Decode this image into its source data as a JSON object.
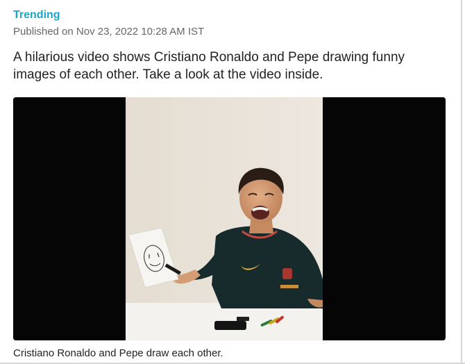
{
  "article": {
    "category": "Trending",
    "published": "Published on Nov 23, 2022 10:28 AM IST",
    "summary": "A hilarious video shows Cristiano Ronaldo and Pepe drawing funny images of each other. Take a look at the video inside."
  },
  "video": {
    "caption": "Cristiano Ronaldo and Pepe draw each other."
  },
  "colors": {
    "category": "#1aa5c8",
    "meta": "#666666",
    "text": "#222222",
    "letterbox": "#050505",
    "backdrop": "#e8e1d7",
    "shirt": "#152a2c",
    "nike_accent": "#d7a83b"
  }
}
